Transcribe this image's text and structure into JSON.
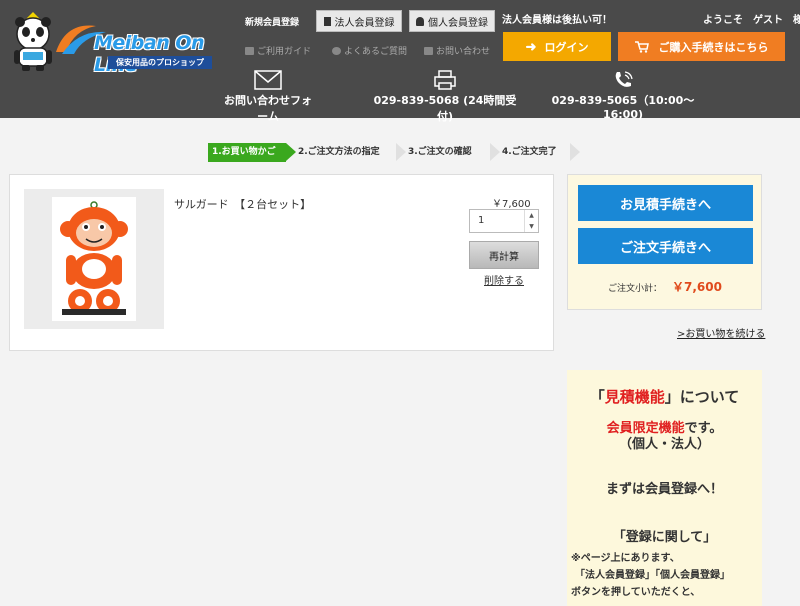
{
  "header": {
    "logo_text": "Meiban On Line",
    "logo_sub": "保安用品のプロショップ",
    "reg_label": "新規会員登録",
    "btn_corp": "法人会員登録",
    "btn_indiv": "個人会員登録",
    "pay_note": "法人会員様は後払い可！",
    "welcome": "ようこそ　ゲスト　様",
    "sub_nav": [
      "ご利用ガイド",
      "よくあるご質問",
      "お問い合わせ"
    ],
    "btn_login": "ログイン",
    "btn_cart": "ご購入手続きはこちら",
    "contact_form": "お問い合わせフォーム",
    "fax": "029-839-5068 (24時間受付)",
    "phone": "029-839-5065（10:00〜16:00)"
  },
  "steps": [
    "1.お買い物かご",
    "2.ご注文方法の指定",
    "3.ご注文の確認",
    "4.ご注文完了"
  ],
  "cart": {
    "product_name": "サルガード　【２台セット】",
    "price": "￥7,600",
    "qty": "1",
    "btn_recalc": "再計算",
    "del_link": "削除する"
  },
  "order": {
    "btn_estimate": "お見積手続きへ",
    "btn_order": "ご注文手続きへ",
    "subtotal_label": "ご注文小計：",
    "subtotal_value": "￥7,600",
    "continue": ">お買い物を続ける"
  },
  "info": {
    "title_quote_open": "「",
    "title_red": "見積機能",
    "title_rest": "」について",
    "members_red": "会員限定機能",
    "members_rest": "です。",
    "members_sub": "（個人・法人）",
    "register": "まずは会員登録へ！",
    "about": "「登録に関して」",
    "body_1": "※ページ上にあります、",
    "body_2": "「法人会員登録」「個人会員登録」",
    "body_3": "ボタンを押していただくと、"
  },
  "colors": {
    "header_bg": "#4a4a4a",
    "login_btn": "#f4a800",
    "cart_btn": "#f07d22",
    "step_active": "#3aa81e",
    "primary_btn": "#1a88d6",
    "price_red": "#e04a1c"
  }
}
